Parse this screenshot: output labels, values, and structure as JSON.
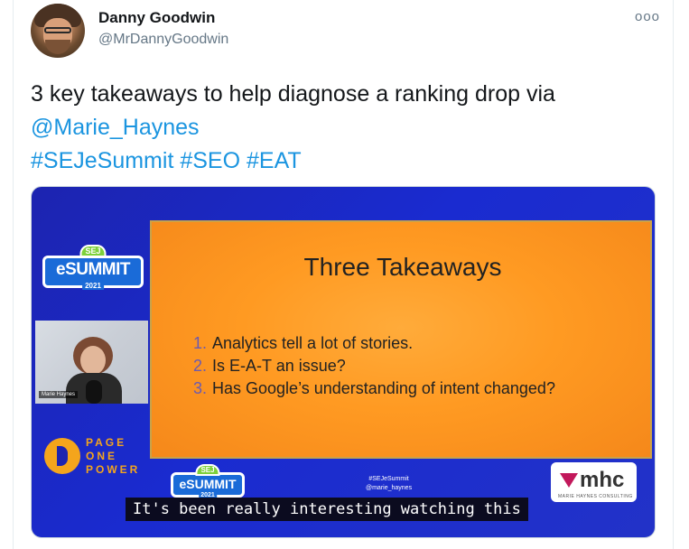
{
  "tweet": {
    "author_name": "Danny Goodwin",
    "author_handle": "@MrDannyGoodwin",
    "more_label": "ooo",
    "text_lines": [
      "3 key takeaways to help diagnose a ranking drop via",
      "@Marie_Haynes",
      "#SEJeSummit #SEO #EAT"
    ],
    "mention": "@Marie_Haynes",
    "hashtags": [
      "#SEJeSummit",
      "#SEO",
      "#EAT"
    ]
  },
  "media": {
    "slide_title": "Three Takeaways",
    "slide_items": [
      {
        "num": "1.",
        "text": "Analytics tell a lot of stories."
      },
      {
        "num": "2.",
        "text": "Is E-A-T an issue?"
      },
      {
        "num": "3.",
        "text": "Has Google’s understanding of intent changed?"
      }
    ],
    "badge": {
      "sej": "SEJ",
      "word": "eSUMMIT",
      "year": "2021"
    },
    "webcam_caption": "Marie Haynes",
    "sponsor": {
      "line1": "PAGE",
      "line2": "ONE",
      "line3": "POWER"
    },
    "overlay_hashtag": "#SEJeSummit",
    "overlay_handle": "@marie_haynes",
    "mhc": {
      "word": "mhc",
      "sub": "MARIE HAYNES CONSULTING"
    },
    "subtitle": "It's been really interesting watching this"
  },
  "colors": {
    "link": "#1b95e0",
    "text": "#14171a",
    "secondary": "#657786",
    "stage_blue": "#1c24b0",
    "slide_orange": "#ff9a22"
  },
  "icons": [
    "more-options-icon",
    "author-avatar"
  ]
}
